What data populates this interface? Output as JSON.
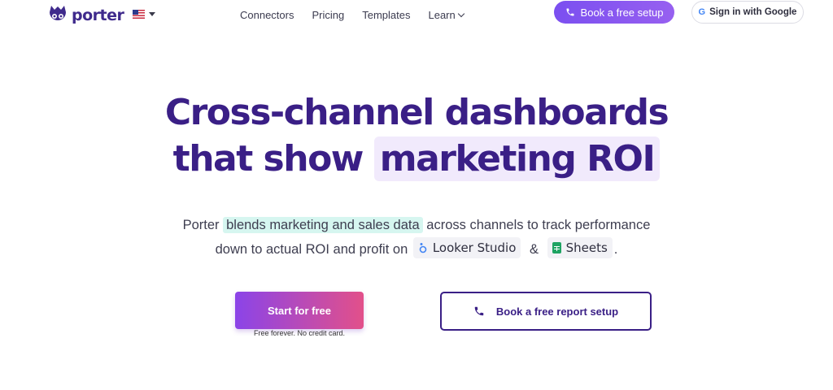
{
  "nav": {
    "brand": "porter",
    "language_flag": "us-flag-icon",
    "menu": [
      "Connectors",
      "Pricing",
      "Templates",
      "Learn"
    ],
    "cta_label": "Book a free setup",
    "google_label": "Sign in with Google",
    "google_mark": "G"
  },
  "hero": {
    "headline_line1": "Cross-channel dashboards",
    "headline_line2_plain": "that show ",
    "headline_line2_highlight": "marketing ROI",
    "sub_prefix": "Porter ",
    "sub_highlight": "blends marketing and sales data",
    "sub_suffix": " across channels to track performance",
    "sub_line2_prefix": "down to actual ROI and profit on ",
    "chip_looker": "Looker Studio",
    "amp": "&",
    "chip_sheets": "Sheets",
    "period": "."
  },
  "actions": {
    "start_label": "Start for free",
    "start_note": "Free forever. No credit card.",
    "book_label": "Book a free report setup"
  },
  "colors": {
    "brand": "#3a1f86",
    "accent": "#7b4ff0",
    "gradient_end": "#e2508a",
    "teal_highlight": "#d6f6f0"
  }
}
